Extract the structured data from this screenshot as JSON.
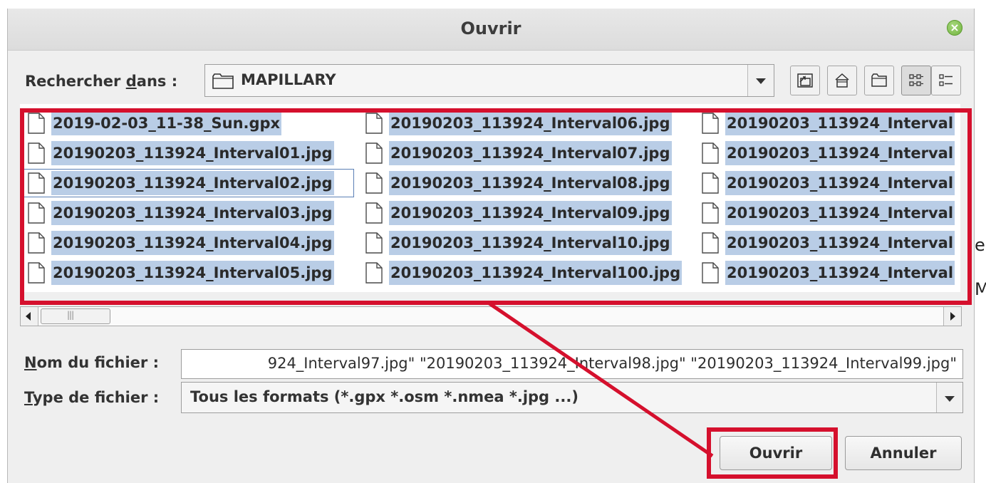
{
  "dialog": {
    "title": "Ouvrir",
    "close_icon": "close-icon"
  },
  "look_in": {
    "label_before": "Rechercher ",
    "label_mnemonic": "d",
    "label_after": "ans :",
    "folder": "MAPILLARY",
    "toolbar_icons": [
      "up-folder-icon",
      "home-icon",
      "new-folder-icon",
      "list-view-icon",
      "details-view-icon"
    ]
  },
  "files": {
    "columns": [
      [
        "2019-02-03_11-38_Sun.gpx",
        "20190203_113924_Interval01.jpg",
        "20190203_113924_Interval02.jpg",
        "20190203_113924_Interval03.jpg",
        "20190203_113924_Interval04.jpg",
        "20190203_113924_Interval05.jpg"
      ],
      [
        "20190203_113924_Interval06.jpg",
        "20190203_113924_Interval07.jpg",
        "20190203_113924_Interval08.jpg",
        "20190203_113924_Interval09.jpg",
        "20190203_113924_Interval10.jpg",
        "20190203_113924_Interval100.jpg"
      ],
      [
        "20190203_113924_Interval",
        "20190203_113924_Interval",
        "20190203_113924_Interval",
        "20190203_113924_Interval",
        "20190203_113924_Interval",
        "20190203_113924_Interval"
      ]
    ],
    "focused": "20190203_113924_Interval02.jpg"
  },
  "filename": {
    "label_mnemonic": "N",
    "label_after": "om du fichier :",
    "value": "924_Interval97.jpg\" \"20190203_113924_Interval98.jpg\" \"20190203_113924_Interval99.jpg\""
  },
  "filetype": {
    "label_mnemonic": "T",
    "label_after": "ype de fichier :",
    "selected": "Tous les formats (*.gpx *.osm *.nmea *.jpg ...)"
  },
  "buttons": {
    "open": "Ouvrir",
    "cancel": "Annuler"
  },
  "background_glyphs": [
    "e",
    "M"
  ],
  "colors": {
    "annotation": "#d5102d",
    "selection": "#b9cde6",
    "close_button": "#6fb23b"
  }
}
